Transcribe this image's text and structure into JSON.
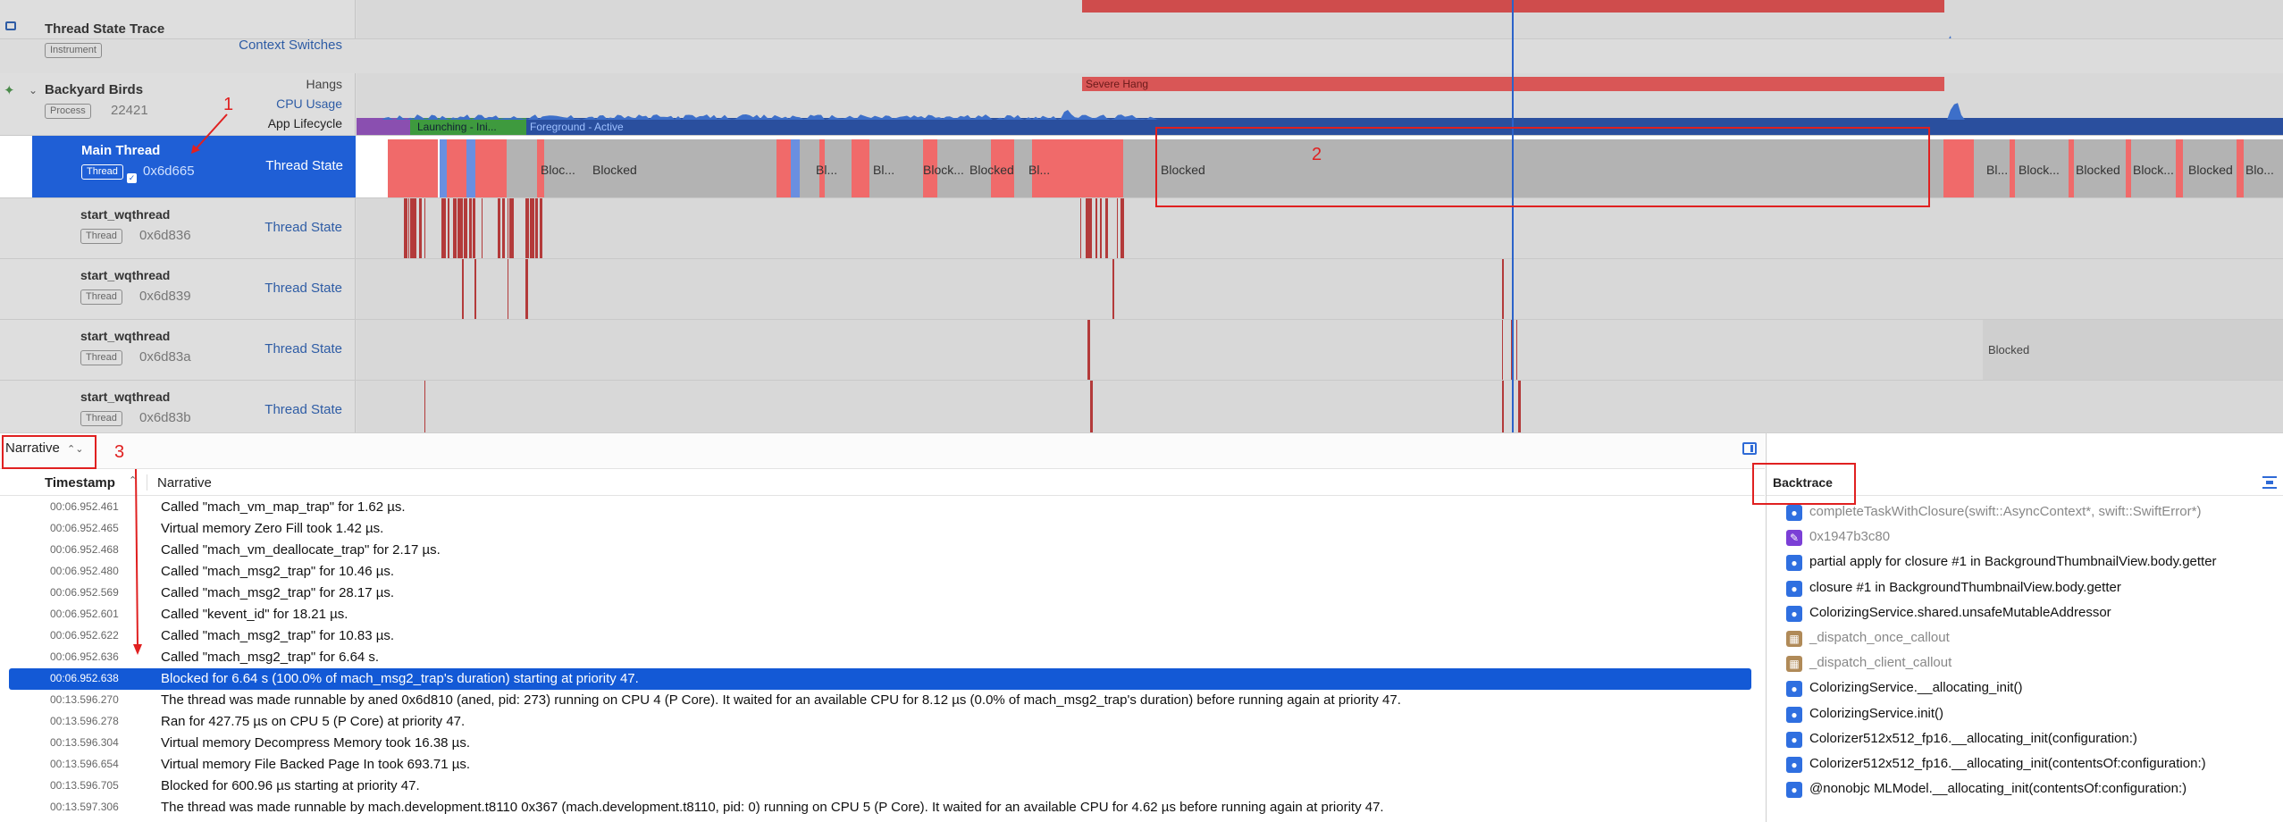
{
  "tracks": {
    "thread_state_trace": {
      "title": "Thread State Trace",
      "badge": "Instrument",
      "right_label": "Context Switches"
    },
    "backyard_birds": {
      "title": "Backyard Birds",
      "badge": "Process",
      "pid": "22421",
      "sub_labels": [
        "Hangs",
        "CPU Usage",
        "App Lifecycle"
      ],
      "hang_label": "Severe Hang",
      "lifecycle_launching": "Launching - Ini...",
      "lifecycle_foreground": "Foreground - Active"
    },
    "main_thread": {
      "title": "Main Thread",
      "badge": "Thread",
      "tid": "0x6d665",
      "right_label": "Thread State",
      "state_labels": [
        "Bloc...",
        "Blocked",
        "Bl...",
        "Bl...",
        "Block...",
        "Blocked",
        "Bl...",
        "Blocked",
        "Bl...",
        "Block...",
        "Blocked",
        "Block...",
        "Blocked",
        "Blo..."
      ]
    },
    "workers": [
      {
        "title": "start_wqthread",
        "badge": "Thread",
        "tid": "0x6d836",
        "right_label": "Thread State"
      },
      {
        "title": "start_wqthread",
        "badge": "Thread",
        "tid": "0x6d839",
        "right_label": "Thread State"
      },
      {
        "title": "start_wqthread",
        "badge": "Thread",
        "tid": "0x6d83a",
        "right_label": "Thread State",
        "state_label": "Blocked"
      },
      {
        "title": "start_wqthread",
        "badge": "Thread",
        "tid": "0x6d83b",
        "right_label": "Thread State"
      }
    ]
  },
  "annotations": {
    "one": "1",
    "two": "2",
    "three": "3"
  },
  "narrative_panel": {
    "mode_select": "Narrative",
    "columns": {
      "timestamp": "Timestamp",
      "narrative": "Narrative"
    },
    "rows": [
      {
        "ts": "00:06.952.461",
        "text": "Called \"mach_vm_map_trap\" for 1.62 µs."
      },
      {
        "ts": "00:06.952.465",
        "text": "Virtual memory Zero Fill took 1.42 µs."
      },
      {
        "ts": "00:06.952.468",
        "text": "Called \"mach_vm_deallocate_trap\" for 2.17 µs."
      },
      {
        "ts": "00:06.952.480",
        "text": "Called \"mach_msg2_trap\" for 10.46 µs."
      },
      {
        "ts": "00:06.952.569",
        "text": "Called \"mach_msg2_trap\" for 28.17 µs."
      },
      {
        "ts": "00:06.952.601",
        "text": "Called \"kevent_id\" for 18.21 µs."
      },
      {
        "ts": "00:06.952.622",
        "text": "Called \"mach_msg2_trap\" for 10.83 µs."
      },
      {
        "ts": "00:06.952.636",
        "text": "Called \"mach_msg2_trap\" for 6.64 s."
      },
      {
        "ts": "00:06.952.638",
        "text": "Blocked for 6.64 s (100.0% of mach_msg2_trap's duration) starting at priority 47.",
        "selected": true
      },
      {
        "ts": "00:13.596.270",
        "text": "The thread was made runnable by aned  0x6d810 (aned, pid: 273) running on CPU 4 (P Core). It waited for an available CPU for 8.12 µs (0.0% of mach_msg2_trap's duration) before running again at priority 47."
      },
      {
        "ts": "00:13.596.278",
        "text": "Ran for 427.75 µs on CPU 5 (P Core) at priority 47."
      },
      {
        "ts": "00:13.596.304",
        "text": "Virtual memory Decompress Memory took 16.38 µs."
      },
      {
        "ts": "00:13.596.654",
        "text": "Virtual memory File Backed Page In took 693.71 µs."
      },
      {
        "ts": "00:13.596.705",
        "text": "Blocked for 600.96 µs starting at priority 47."
      },
      {
        "ts": "00:13.597.306",
        "text": "The thread was made runnable by mach.development.t8110  0x367 (mach.development.t8110, pid: 0) running on CPU 5 (P Core). It waited for an available CPU for 4.62 µs before running again at priority 47."
      }
    ]
  },
  "backtrace": {
    "title": "Backtrace",
    "frames": [
      {
        "name": "completeTaskWithClosure(swift::AsyncContext*, swift::SwiftError*)",
        "icon": "user-frame-icon",
        "color": "#2f6fe0",
        "dim": true
      },
      {
        "name": "0x1947b3c80",
        "icon": "unsymbolicated-frame-icon",
        "color": "#7b3fd6",
        "dim": true
      },
      {
        "name": "partial apply for closure #1 in BackgroundThumbnailView.body.getter",
        "icon": "user-frame-icon",
        "color": "#2f6fe0"
      },
      {
        "name": "closure #1 in BackgroundThumbnailView.body.getter",
        "icon": "user-frame-icon",
        "color": "#2f6fe0"
      },
      {
        "name": "ColorizingService.shared.unsafeMutableAddressor",
        "icon": "user-frame-icon",
        "color": "#2f6fe0"
      },
      {
        "name": "_dispatch_once_callout",
        "icon": "library-frame-icon",
        "color": "#b08a58",
        "dim": true
      },
      {
        "name": "_dispatch_client_callout",
        "icon": "library-frame-icon",
        "color": "#b08a58",
        "dim": true
      },
      {
        "name": "ColorizingService.__allocating_init()",
        "icon": "user-frame-icon",
        "color": "#2f6fe0"
      },
      {
        "name": "ColorizingService.init()",
        "icon": "user-frame-icon",
        "color": "#2f6fe0"
      },
      {
        "name": "Colorizer512x512_fp16.__allocating_init(configuration:)",
        "icon": "user-frame-icon",
        "color": "#2f6fe0"
      },
      {
        "name": "Colorizer512x512_fp16.__allocating_init(contentsOf:configuration:)",
        "icon": "user-frame-icon",
        "color": "#2f6fe0"
      },
      {
        "name": "@nonobjc MLModel.__allocating_init(contentsOf:configuration:)",
        "icon": "user-frame-icon",
        "color": "#2f6fe0"
      }
    ]
  },
  "colors": {
    "selection": "#1359d6",
    "annotation": "#e02020",
    "running": "#f06a6a",
    "blocked": "#b3b3b3",
    "preempted": "#6a8fe0",
    "worker_running": "#b33a3a"
  }
}
